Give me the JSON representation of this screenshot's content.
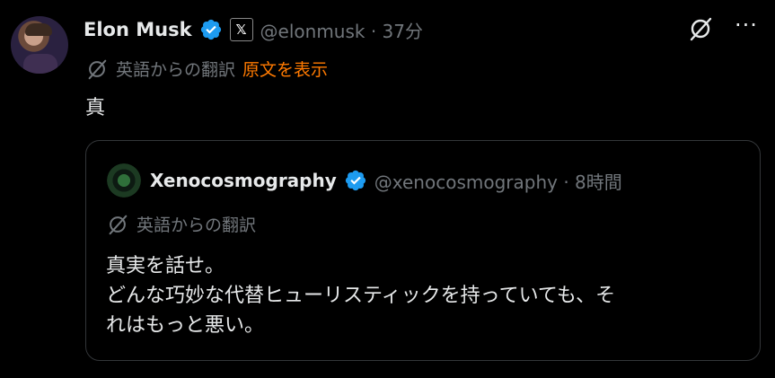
{
  "tweet": {
    "author_name": "Elon Musk",
    "x_badge": "𝕏",
    "handle_time": "@elonmusk · 37分",
    "translate_label": "英語からの翻訳",
    "show_original": "原文を表示",
    "text": "真",
    "more_label": "···"
  },
  "quote": {
    "author_name": "Xenocosmography",
    "handle_time": "@xenocosmography · 8時間",
    "translate_label": "英語からの翻訳",
    "lines": [
      "真実を話せ。",
      "どんな巧妙な代替ヒューリスティックを持っていても、そ",
      "れはもっと悪い。"
    ]
  },
  "colors": {
    "background": "#000000",
    "text": "#e7e9ea",
    "muted": "#71767b",
    "verified": "#1d9bf0",
    "link": "#ff7a00",
    "border": "#333639"
  }
}
